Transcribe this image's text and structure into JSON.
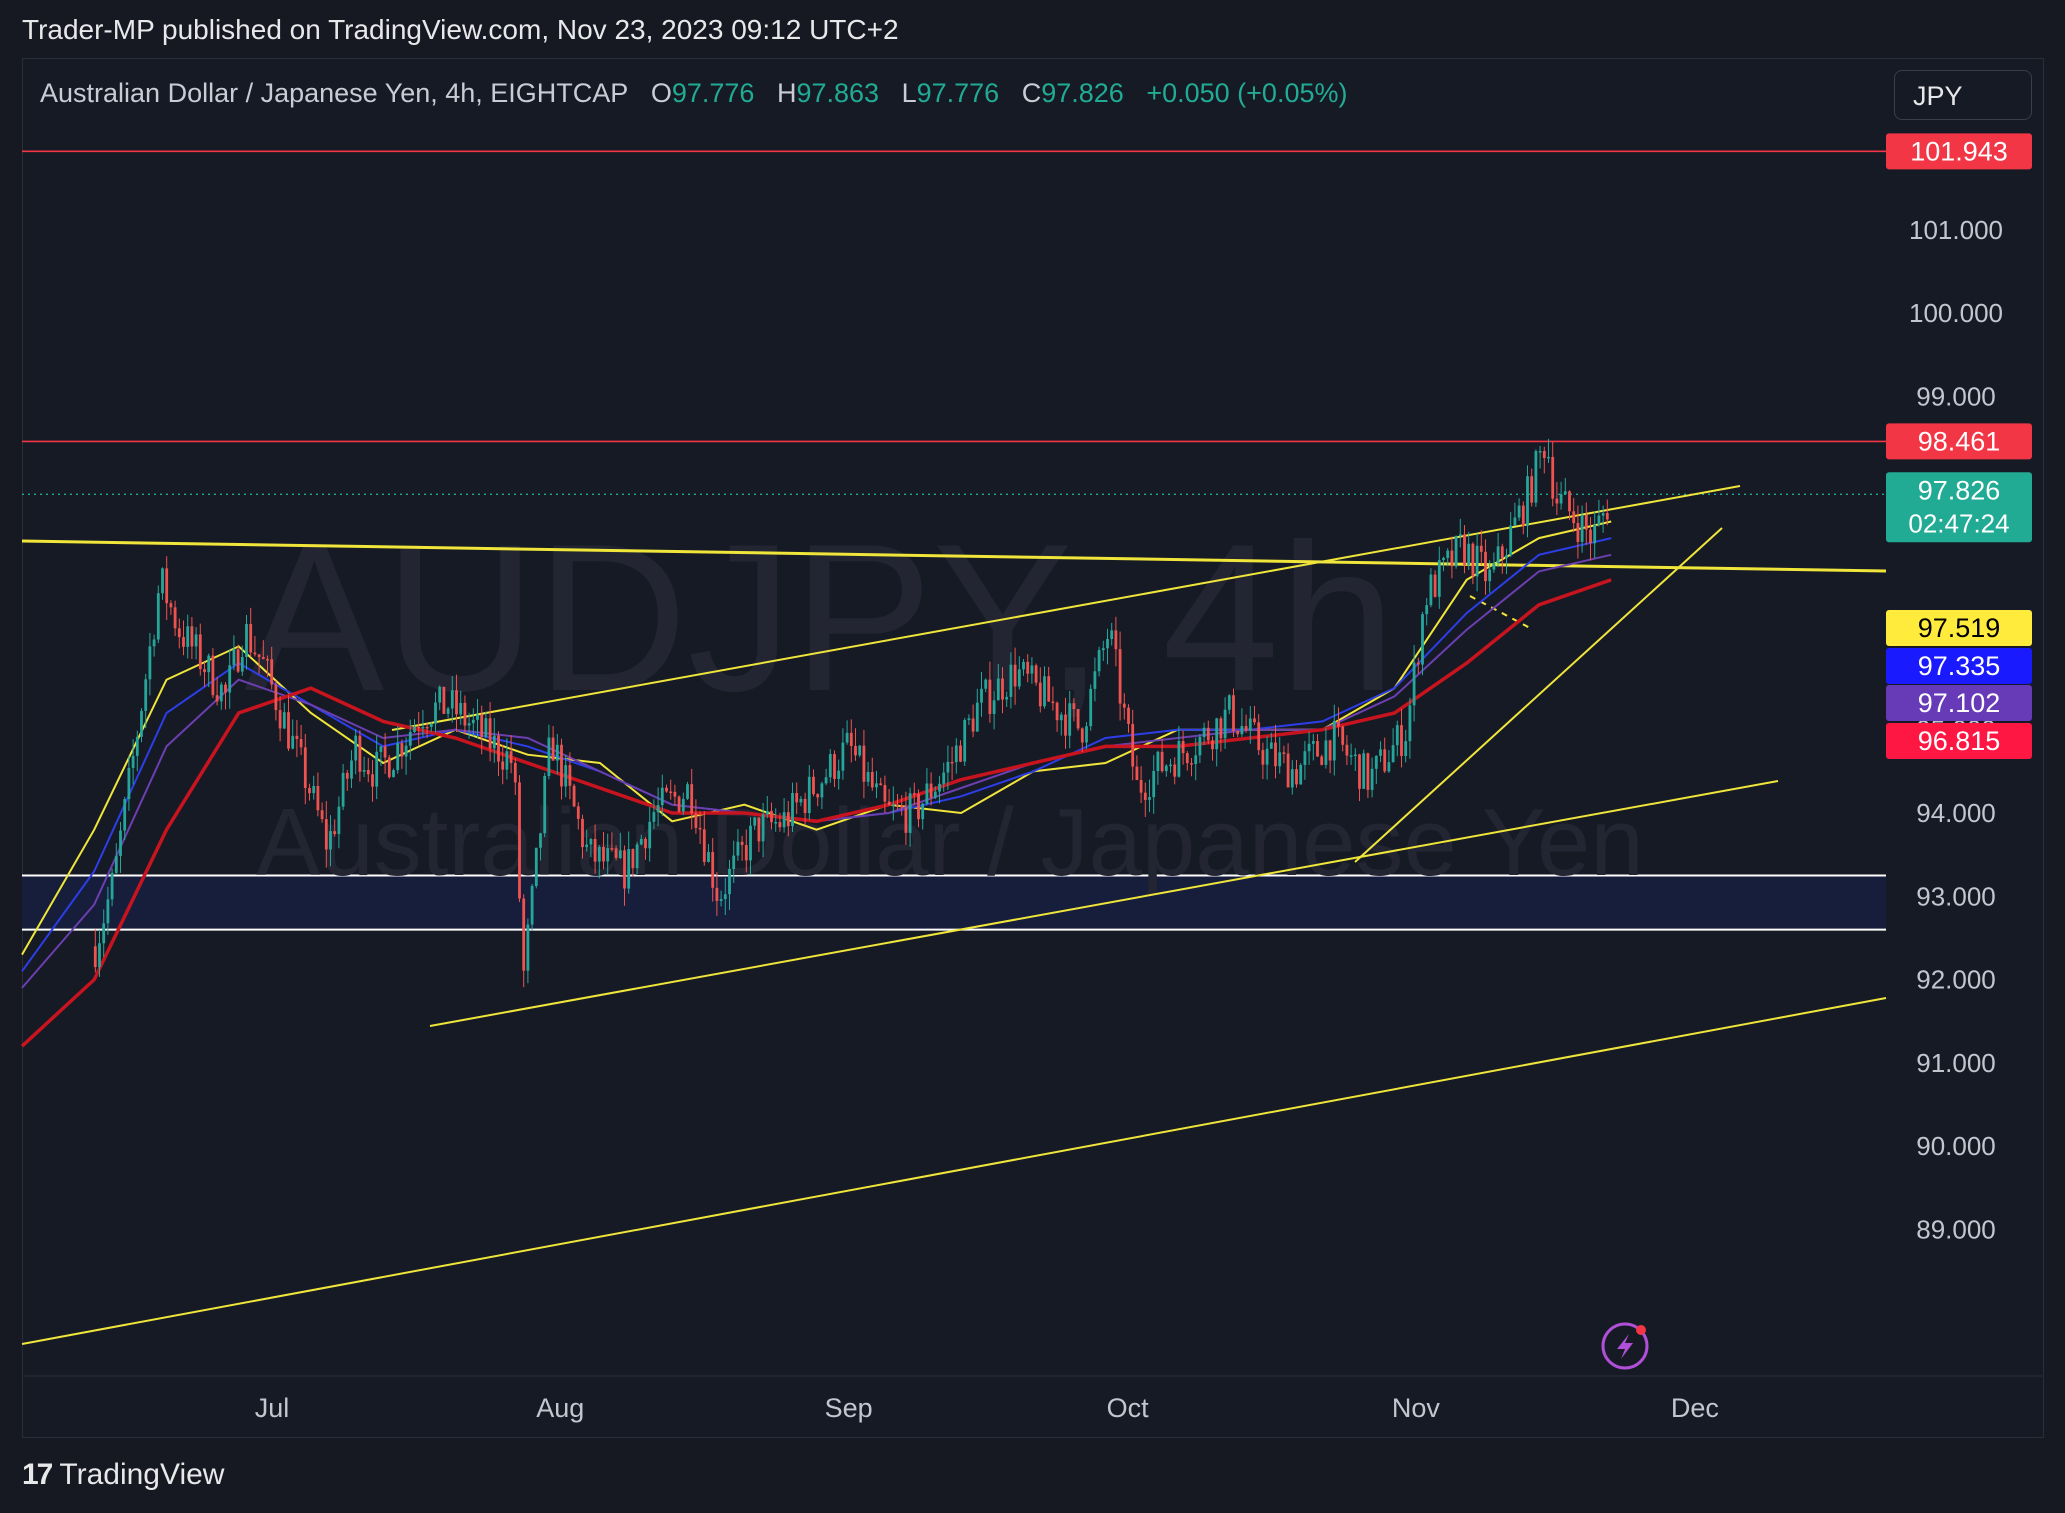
{
  "header": {
    "published_by": "Trader-MP published on TradingView.com, Nov 23, 2023 09:12 UTC+2",
    "currency_button": "JPY"
  },
  "legend": {
    "symbol": "Australian Dollar / Japanese Yen, 4h, EIGHTCAP",
    "o_label": "O",
    "o_value": "97.776",
    "h_label": "H",
    "h_value": "97.863",
    "l_label": "L",
    "l_value": "97.776",
    "c_label": "C",
    "c_value": "97.826",
    "change": "+0.050 (+0.05%)"
  },
  "watermark": {
    "ticker": "AUDJPY, 4h",
    "name": "Australian Dollar / Japanese Yen"
  },
  "footer": {
    "brand": "TradingView"
  },
  "colors": {
    "up": "#26a69a",
    "down": "#ef5350",
    "trendline": "#f0e53a",
    "level": "#f23645",
    "bg": "#161a25"
  },
  "chart_data": {
    "type": "line",
    "ylim": [
      88.0,
      103.0
    ],
    "y_ticks": [
      "89.000",
      "90.000",
      "91.000",
      "92.000",
      "93.000",
      "94.000",
      "95.000",
      "99.000",
      "100.000",
      "101.000"
    ],
    "x_ticks": [
      "Jul",
      "Aug",
      "Sep",
      "Oct",
      "Nov",
      "Dec"
    ],
    "horizontal_levels": [
      {
        "name": "resistance-high",
        "value": 101.943,
        "label": "101.943"
      },
      {
        "name": "resistance-mid",
        "value": 98.461,
        "label": "98.461"
      }
    ],
    "demand_zone": [
      92.6,
      93.25
    ],
    "price_labels": [
      {
        "value": 97.826,
        "label": "97.826",
        "sub": "02:47:24",
        "color": "#22ab94"
      },
      {
        "value": 97.519,
        "label": "97.519",
        "color": "#ffeb3b",
        "text_color": "#000000"
      },
      {
        "value": 97.335,
        "label": "97.335",
        "color": "#1a1aff"
      },
      {
        "value": 97.102,
        "label": "97.102",
        "color": "#673ab7"
      },
      {
        "value": 96.815,
        "label": "96.815",
        "color": "#ff1744"
      }
    ],
    "price_path": [
      [
        "Jun 12",
        92.4
      ],
      [
        "Jun 14",
        93.2
      ],
      [
        "Jun 16",
        94.6
      ],
      [
        "Jun 19",
        96.8
      ],
      [
        "Jun 21",
        96.2
      ],
      [
        "Jun 23",
        95.9
      ],
      [
        "Jun 26",
        95.4
      ],
      [
        "Jun 28",
        96.2
      ],
      [
        "Jun 30",
        95.8
      ],
      [
        "Jul 5",
        94.3
      ],
      [
        "Jul 7",
        93.6
      ],
      [
        "Jul 10",
        94.8
      ],
      [
        "Jul 12",
        94.5
      ],
      [
        "Jul 14",
        94.7
      ],
      [
        "Jul 17",
        95.2
      ],
      [
        "Jul 20",
        95.3
      ],
      [
        "Jul 24",
        94.9
      ],
      [
        "Jul 27",
        94.6
      ],
      [
        "Jul 28",
        92.0
      ],
      [
        "Jul 31",
        94.9
      ],
      [
        "Aug 2",
        94.2
      ],
      [
        "Aug 4",
        93.5
      ],
      [
        "Aug 8",
        93.3
      ],
      [
        "Aug 11",
        94.0
      ],
      [
        "Aug 15",
        94.3
      ],
      [
        "Aug 18",
        93.0
      ],
      [
        "Aug 22",
        93.8
      ],
      [
        "Aug 25",
        93.9
      ],
      [
        "Aug 29",
        94.4
      ],
      [
        "Sep 1",
        94.8
      ],
      [
        "Sep 5",
        94.0
      ],
      [
        "Sep 8",
        94.0
      ],
      [
        "Sep 12",
        94.6
      ],
      [
        "Sep 15",
        95.3
      ],
      [
        "Sep 19",
        95.7
      ],
      [
        "Sep 22",
        95.4
      ],
      [
        "Sep 26",
        95.0
      ],
      [
        "Sep 29",
        96.2
      ],
      [
        "Oct 2",
        94.3
      ],
      [
        "Oct 5",
        94.6
      ],
      [
        "Oct 9",
        94.9
      ],
      [
        "Oct 12",
        95.2
      ],
      [
        "Oct 16",
        94.7
      ],
      [
        "Oct 19",
        94.5
      ],
      [
        "Oct 23",
        94.9
      ],
      [
        "Oct 27",
        94.4
      ],
      [
        "Oct 31",
        95.0
      ],
      [
        "Nov 2",
        96.6
      ],
      [
        "Nov 6",
        97.2
      ],
      [
        "Nov 9",
        96.8
      ],
      [
        "Nov 13",
        97.8
      ],
      [
        "Nov 15",
        98.5
      ],
      [
        "Nov 16",
        97.8
      ],
      [
        "Nov 20",
        97.3
      ],
      [
        "Nov 22",
        97.8
      ]
    ],
    "moving_averages": [
      {
        "color": "#f0e53a",
        "values": [
          92.3,
          93.8,
          95.6,
          96.0,
          95.2,
          94.6,
          95.0,
          94.7,
          94.6,
          93.9,
          94.1,
          93.8,
          94.1,
          94.0,
          94.5,
          94.6,
          95.0,
          95.0,
          95.0,
          95.5,
          96.8,
          97.3,
          97.5
        ]
      },
      {
        "color": "#2c3ee8",
        "values": [
          92.1,
          93.3,
          95.2,
          95.8,
          95.3,
          94.8,
          95.0,
          94.8,
          94.5,
          94.1,
          94.0,
          93.9,
          94.0,
          94.2,
          94.5,
          94.9,
          95.0,
          95.0,
          95.1,
          95.5,
          96.4,
          97.1,
          97.3
        ]
      },
      {
        "color": "#6b3fb0",
        "values": [
          91.9,
          92.9,
          94.8,
          95.6,
          95.3,
          94.9,
          95.0,
          94.9,
          94.5,
          94.1,
          94.0,
          93.9,
          94.0,
          94.3,
          94.6,
          94.8,
          94.9,
          95.0,
          95.0,
          95.4,
          96.2,
          96.9,
          97.1
        ]
      },
      {
        "color": "#c8141e",
        "values": [
          91.2,
          92.0,
          93.8,
          95.2,
          95.5,
          95.1,
          94.9,
          94.6,
          94.3,
          94.0,
          94.0,
          93.9,
          94.1,
          94.4,
          94.6,
          94.8,
          94.8,
          94.9,
          95.0,
          95.2,
          95.8,
          96.5,
          96.8
        ]
      }
    ]
  }
}
